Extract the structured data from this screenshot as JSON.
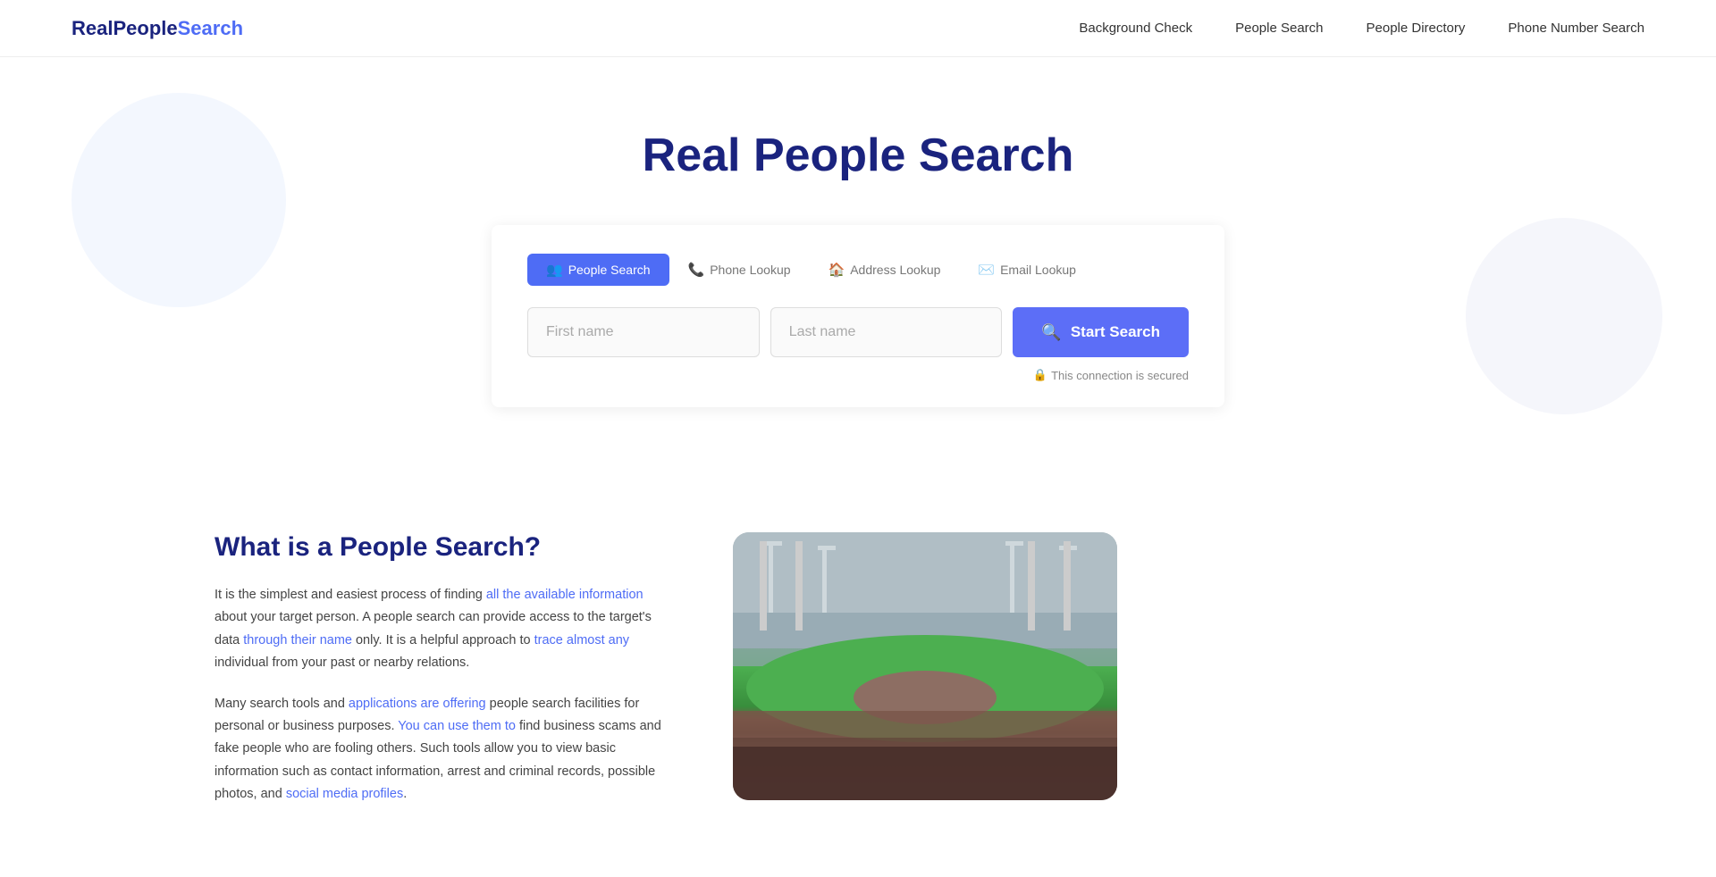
{
  "nav": {
    "logo": {
      "real": "Real",
      "people": "People",
      "search": "Search"
    },
    "links": [
      {
        "id": "background-check",
        "label": "Background Check"
      },
      {
        "id": "people-search",
        "label": "People Search"
      },
      {
        "id": "people-directory",
        "label": "People Directory"
      },
      {
        "id": "phone-number-search",
        "label": "Phone Number Search"
      }
    ]
  },
  "hero": {
    "title": "Real People Search"
  },
  "search": {
    "tabs": [
      {
        "id": "people-search",
        "label": "People Search",
        "icon": "👥",
        "active": true
      },
      {
        "id": "phone-lookup",
        "label": "Phone Lookup",
        "icon": "📞",
        "active": false
      },
      {
        "id": "address-lookup",
        "label": "Address Lookup",
        "icon": "🏠",
        "active": false
      },
      {
        "id": "email-lookup",
        "label": "Email Lookup",
        "icon": "✉️",
        "active": false
      }
    ],
    "first_name_placeholder": "First name",
    "last_name_placeholder": "Last name",
    "button_label": "Start Search",
    "secure_label": "This connection is secured"
  },
  "content": {
    "title": "What is a People Search?",
    "para1": "It is the simplest and easiest process of finding all the available information about your target person. A people search can provide access to the target's data through their name only. It is a helpful approach to trace almost any individual from your past or nearby relations.",
    "para2": "Many search tools and applications are offering people search facilities for personal or business purposes. You can use them to find business scams and fake people who are fooling others. Such tools allow you to view basic information such as contact information, arrest and criminal records, possible photos, and social media profiles."
  }
}
